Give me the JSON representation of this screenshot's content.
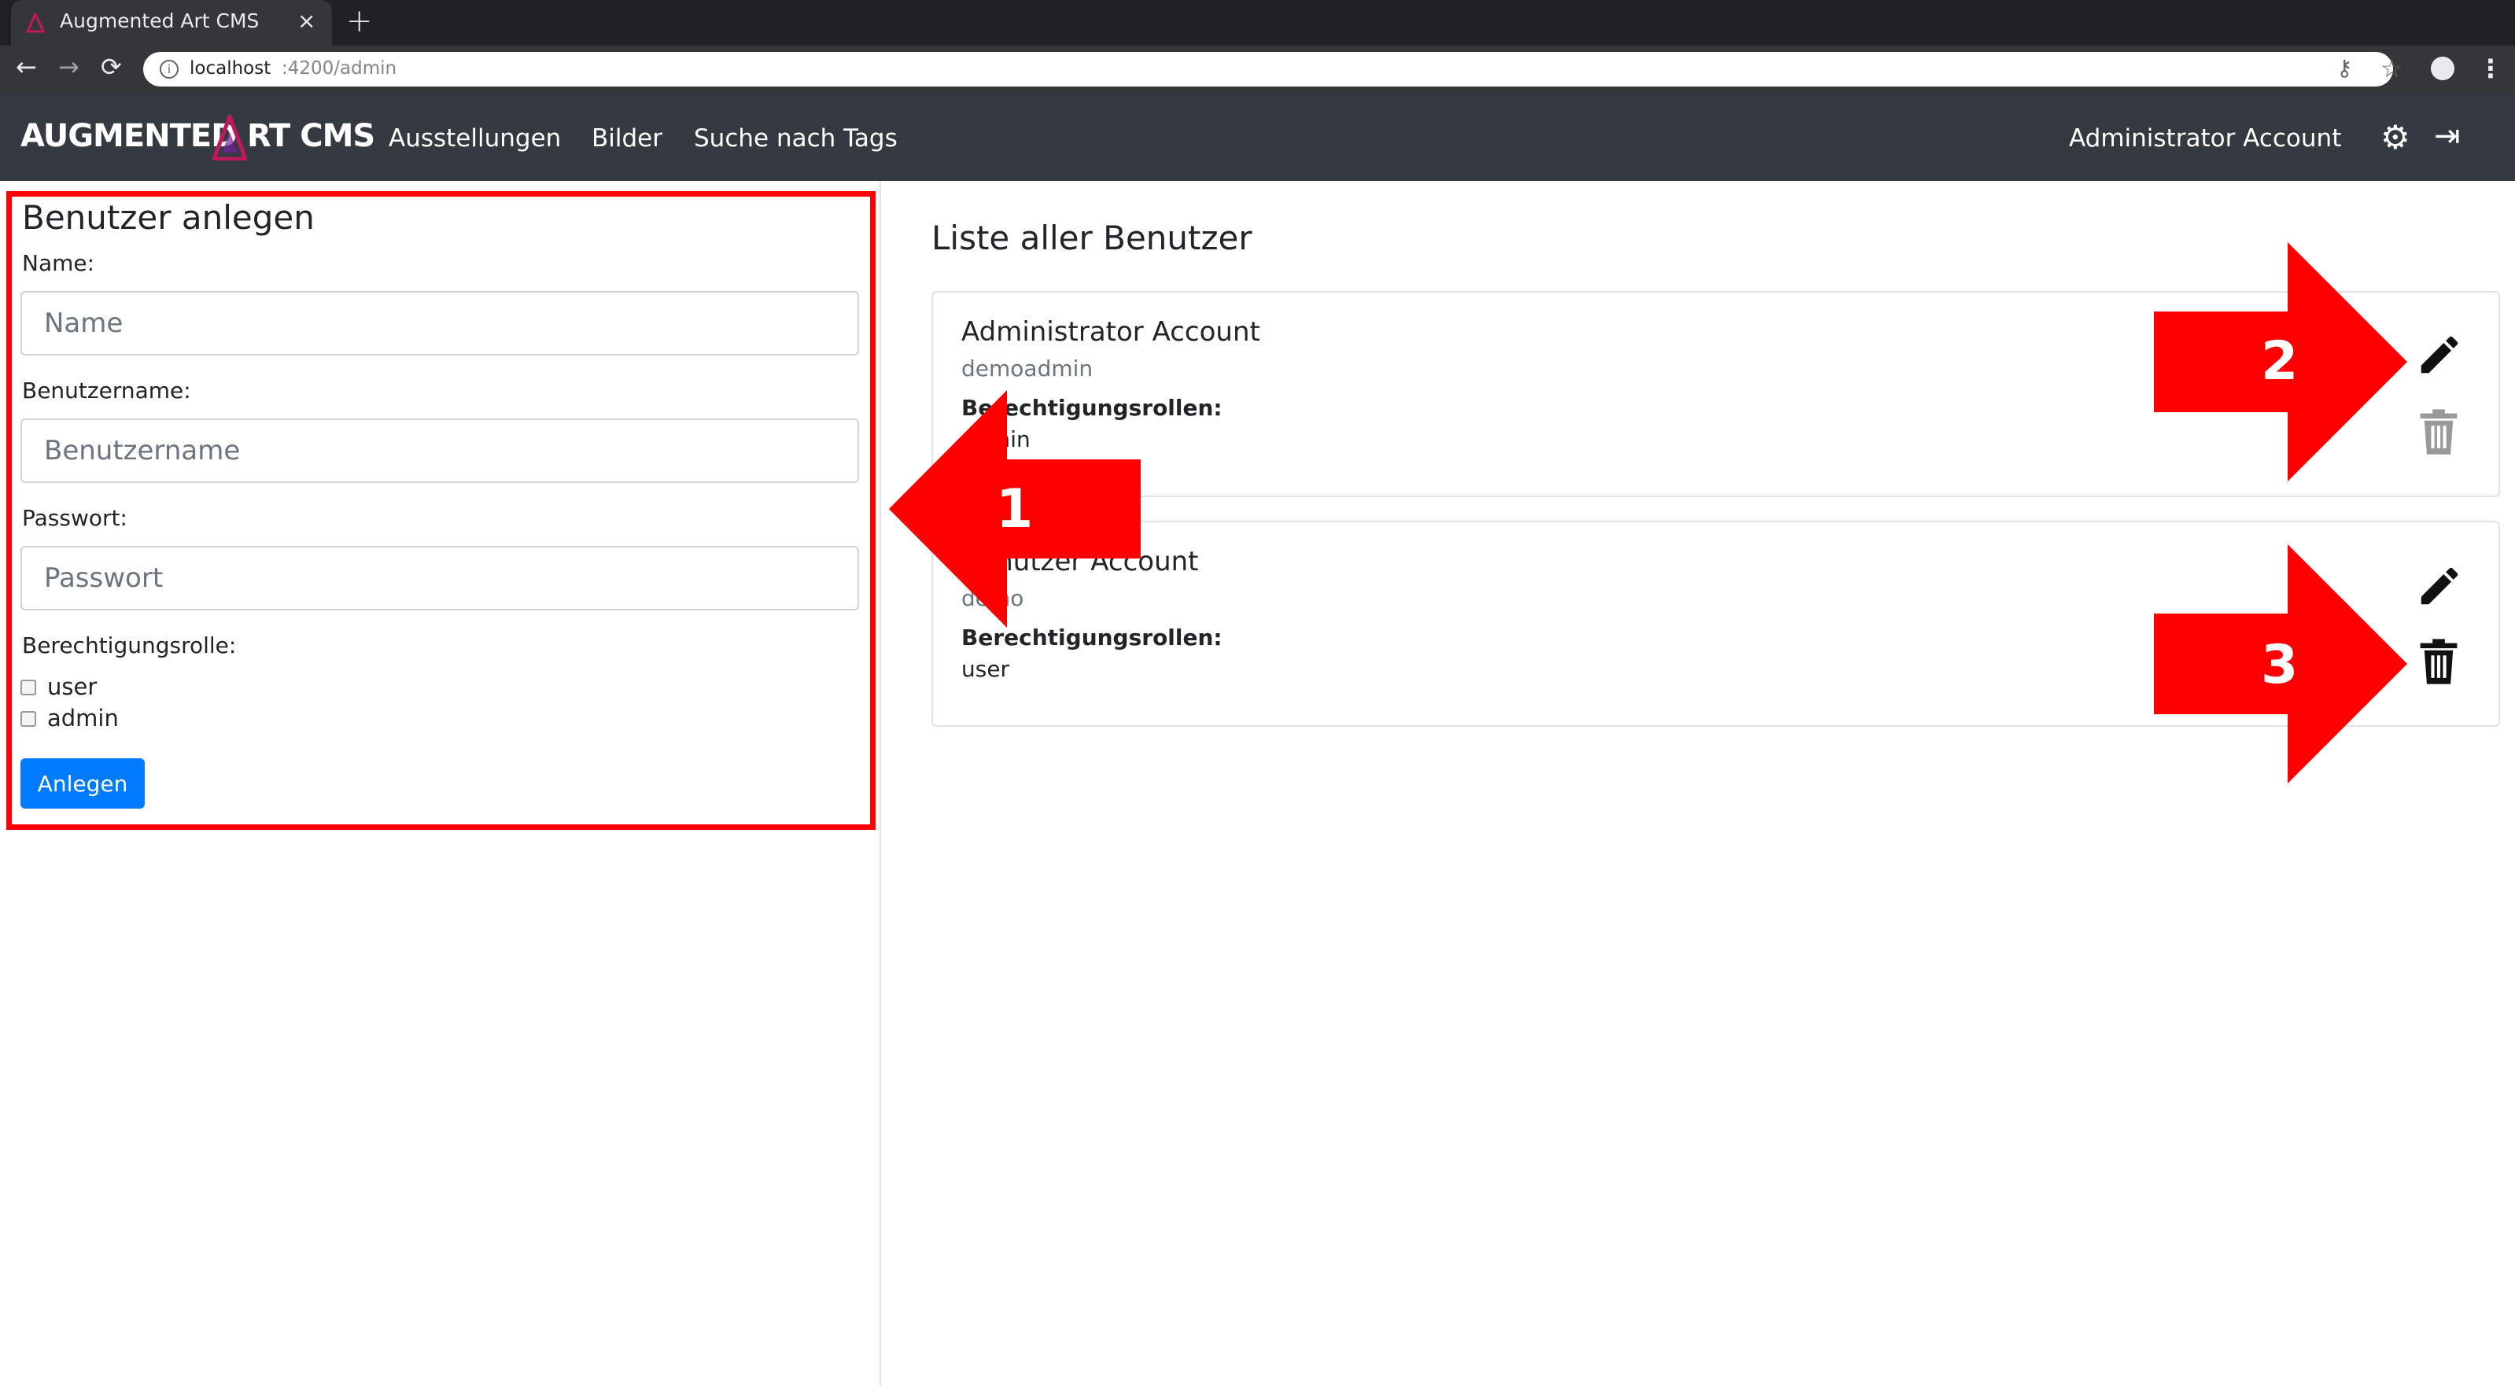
{
  "browser": {
    "tab_title": "Augmented Art CMS",
    "tab_close": "×",
    "new_tab": "+",
    "back": "←",
    "forward": "→",
    "reload": "⟳",
    "info": "i",
    "url_host": "localhost",
    "url_path": ":4200/admin",
    "key_icon": "⚷",
    "star_icon": "☆",
    "menu_icon": "⋮"
  },
  "app_nav": {
    "brand_prefix": "AUGMENTED",
    "brand_suffix": "RT CMS",
    "links": [
      "Ausstellungen",
      "Bilder",
      "Suche nach Tags"
    ],
    "account": "Administrator Account",
    "gear_icon": "⚙",
    "logout_icon": "⇥"
  },
  "create_form": {
    "title": "Benutzer anlegen",
    "name_label": "Name:",
    "name_placeholder": "Name",
    "username_label": "Benutzername:",
    "username_placeholder": "Benutzername",
    "password_label": "Passwort:",
    "password_placeholder": "Passwort",
    "role_label": "Berechtigungsrolle:",
    "roles": [
      "user",
      "admin"
    ],
    "submit": "Anlegen"
  },
  "user_list": {
    "title": "Liste aller Benutzer",
    "roles_label": "Berechtigungsrollen:",
    "users": [
      {
        "name": "Administrator Account",
        "username": "demoadmin",
        "roles": "admin"
      },
      {
        "name": "Benutzer Account",
        "username": "demo",
        "roles": "user"
      }
    ]
  },
  "annotations": {
    "numbers": [
      "1",
      "2",
      "3"
    ],
    "color": "#ff0000"
  },
  "colors": {
    "primary": "#007bff",
    "navbar": "#343a40",
    "highlight": "#ff0000",
    "logo_accent": "#c2185b"
  }
}
